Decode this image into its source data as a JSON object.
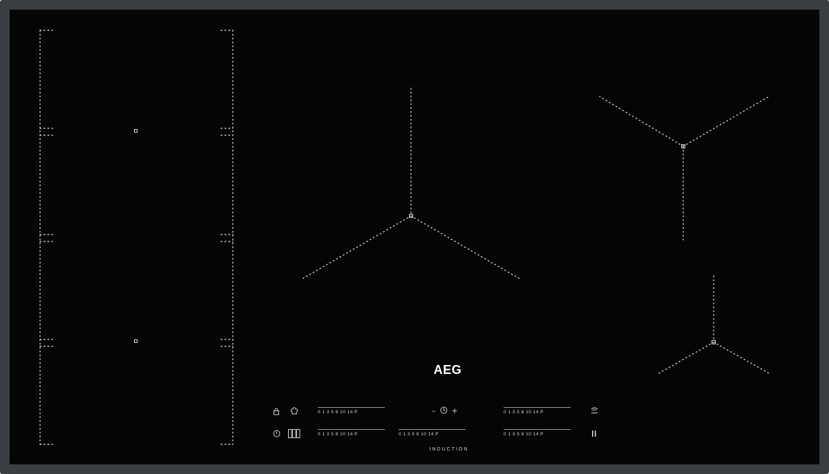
{
  "brand": "AEG",
  "subtitle": "INDUCTION",
  "slider_scale": "0 1 3 5 8 10 14 P",
  "timer": {
    "minus": "–",
    "icon": "clock-icon",
    "plus": "+"
  },
  "icons": {
    "lock": "lock-icon",
    "chef": "chef-hat-icon",
    "power": "power-icon",
    "display": "segment-display-icon",
    "hob2hood": "hob2hood-icon",
    "pause": "pause-icon"
  },
  "colors": {
    "glass": "#050505",
    "frame": "#3a3d42",
    "markings": "#d8d8d8"
  }
}
